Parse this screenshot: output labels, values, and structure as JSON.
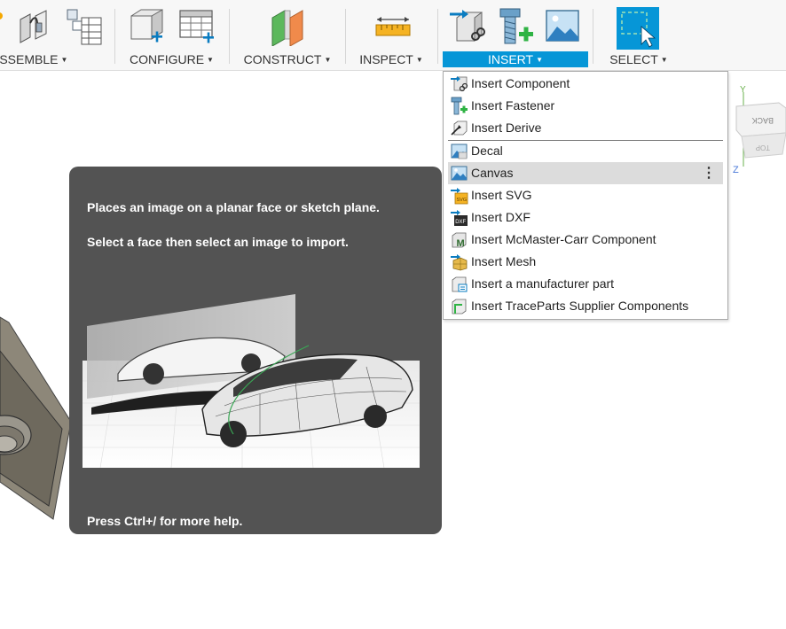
{
  "toolbar": {
    "groups": {
      "assemble": "ASSEMBLE",
      "configure": "CONFIGURE",
      "construct": "CONSTRUCT",
      "inspect": "INSPECT",
      "insert": "INSERT",
      "select": "SELECT"
    },
    "caret": "▼"
  },
  "insert_menu": {
    "items": [
      {
        "label": "Insert Component",
        "icon": "insert-component-icon"
      },
      {
        "label": "Insert Fastener",
        "icon": "insert-fastener-icon"
      },
      {
        "label": "Insert Derive",
        "icon": "insert-derive-icon"
      },
      {
        "label": "Decal",
        "icon": "decal-icon"
      },
      {
        "label": "Canvas",
        "icon": "canvas-icon",
        "highlighted": true
      },
      {
        "label": "Insert SVG",
        "icon": "insert-svg-icon"
      },
      {
        "label": "Insert DXF",
        "icon": "insert-dxf-icon"
      },
      {
        "label": "Insert McMaster-Carr Component",
        "icon": "mcmaster-icon"
      },
      {
        "label": "Insert Mesh",
        "icon": "insert-mesh-icon"
      },
      {
        "label": "Insert a manufacturer part",
        "icon": "manufacturer-part-icon"
      },
      {
        "label": "Insert TraceParts Supplier Components",
        "icon": "traceparts-icon"
      }
    ],
    "more_glyph": "⋮",
    "svg_badge": "SVG",
    "dxf_badge": "DXF",
    "mcmaster_badge": "M"
  },
  "tooltip": {
    "line1": "Places an image on a planar face or sketch plane.",
    "line2": "Select a face then select an image to import.",
    "help": "Press Ctrl+/ for more help."
  },
  "viewcube": {
    "face_back": "BACK",
    "face_top": "TOP",
    "axis_y": "Y",
    "axis_z": "Z"
  },
  "colors": {
    "accent": "#0696d7",
    "tooltip_bg": "#535353",
    "menu_highlight": "#dcdcdc"
  }
}
